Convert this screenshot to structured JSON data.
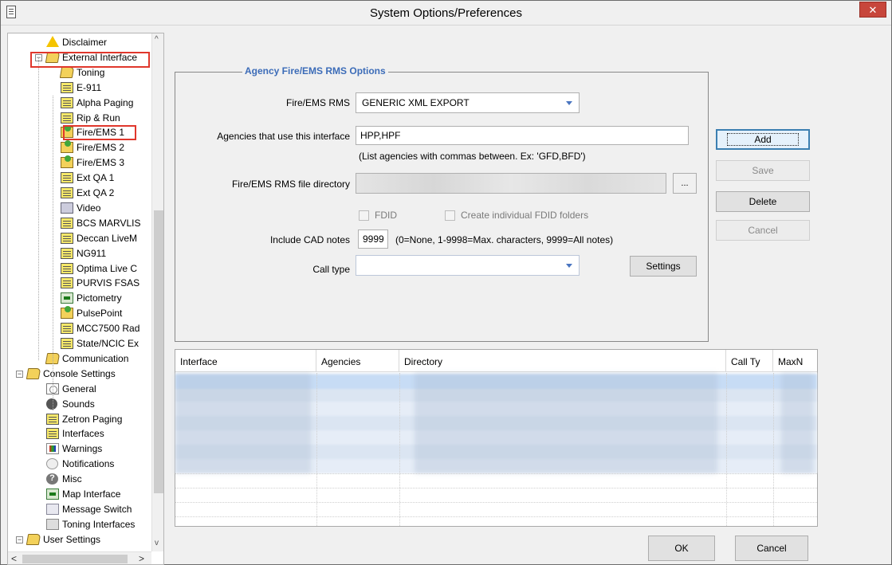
{
  "window": {
    "title": "System Options/Preferences",
    "close_glyph": "✕"
  },
  "tree": {
    "items": [
      {
        "label": "Disclaimer",
        "icon": "warning-icon"
      },
      {
        "label": "External Interface",
        "icon": "folder-icon"
      },
      {
        "label": "Toning",
        "icon": "folder-icon"
      },
      {
        "label": "E-911",
        "icon": "document-icon"
      },
      {
        "label": "Alpha Paging",
        "icon": "document-icon"
      },
      {
        "label": "Rip & Run",
        "icon": "document-icon"
      },
      {
        "label": "Fire/EMS 1",
        "icon": "folder-arrow-icon"
      },
      {
        "label": "Fire/EMS 2",
        "icon": "folder-arrow-icon"
      },
      {
        "label": "Fire/EMS 3",
        "icon": "folder-arrow-icon"
      },
      {
        "label": "Ext QA 1",
        "icon": "document-icon"
      },
      {
        "label": "Ext QA 2",
        "icon": "document-icon"
      },
      {
        "label": "Video",
        "icon": "video-icon"
      },
      {
        "label": "BCS MARVLIS",
        "icon": "document-icon"
      },
      {
        "label": "Deccan LiveM",
        "icon": "document-icon"
      },
      {
        "label": "NG911",
        "icon": "document-icon"
      },
      {
        "label": "Optima Live C",
        "icon": "document-icon"
      },
      {
        "label": "PURVIS FSAS",
        "icon": "document-icon"
      },
      {
        "label": "Pictometry",
        "icon": "map-icon"
      },
      {
        "label": "PulsePoint",
        "icon": "folder-arrow-icon"
      },
      {
        "label": "MCC7500 Rad",
        "icon": "document-icon"
      },
      {
        "label": "State/NCIC Ex",
        "icon": "document-icon"
      },
      {
        "label": "Communication",
        "icon": "folder-icon"
      },
      {
        "label": "Console Settings",
        "icon": "folder-icon"
      },
      {
        "label": "General",
        "icon": "gear-icon"
      },
      {
        "label": "Sounds",
        "icon": "speaker-icon"
      },
      {
        "label": "Zetron Paging",
        "icon": "document-icon"
      },
      {
        "label": "Interfaces",
        "icon": "document-icon"
      },
      {
        "label": "Warnings",
        "icon": "warnings-icon"
      },
      {
        "label": "Notifications",
        "icon": "bubble-icon"
      },
      {
        "label": "Misc",
        "icon": "help-icon"
      },
      {
        "label": "Map Interface",
        "icon": "map-icon"
      },
      {
        "label": "Message Switch",
        "icon": "message-icon"
      },
      {
        "label": "Toning Interfaces",
        "icon": "toning-icon"
      },
      {
        "label": "User Settings",
        "icon": "folder-icon"
      }
    ]
  },
  "group": {
    "title": "Agency Fire/EMS RMS Options",
    "rms_label": "Fire/EMS RMS",
    "rms_value": "GENERIC XML EXPORT",
    "agencies_label": "Agencies that use this interface",
    "agencies_value": "HPP,HPF",
    "agencies_hint": "(List agencies with commas between.  Ex: 'GFD,BFD')",
    "dir_label": "Fire/EMS RMS file directory",
    "browse_label": "...",
    "fdid_label": "FDID",
    "fdid_folders_label": "Create individual FDID folders",
    "notes_label": "Include CAD notes",
    "notes_value": "9999",
    "notes_hint": "(0=None, 1-9998=Max. characters, 9999=All notes)",
    "calltype_label": "Call type",
    "settings_label": "Settings"
  },
  "actions": {
    "add": "Add",
    "save": "Save",
    "delete": "Delete",
    "cancel": "Cancel"
  },
  "table": {
    "columns": [
      "Interface",
      "Agencies",
      "Directory",
      "Call Ty",
      "MaxN"
    ]
  },
  "footer": {
    "ok": "OK",
    "cancel": "Cancel"
  },
  "scroll": {
    "left": "<",
    "right": ">",
    "up": "^",
    "down": "v"
  }
}
